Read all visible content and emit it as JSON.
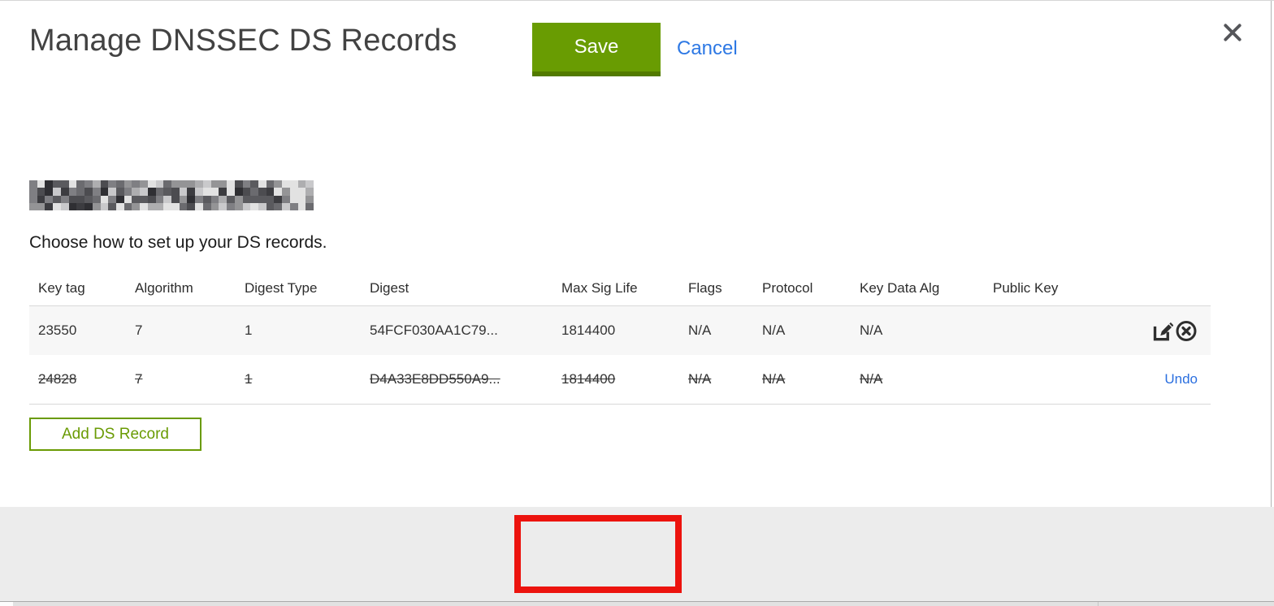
{
  "modal": {
    "title": "Manage DNSSEC DS Records"
  },
  "intro": "Choose how to set up your DS records.",
  "table": {
    "headers": [
      "Key tag",
      "Algorithm",
      "Digest Type",
      "Digest",
      "Max Sig Life",
      "Flags",
      "Protocol",
      "Key Data Alg",
      "Public Key"
    ],
    "rows": [
      {
        "key_tag": "23550",
        "algorithm": "7",
        "digest_type": "1",
        "digest": "54FCF030AA1C79...",
        "max_sig_life": "1814400",
        "flags": "N/A",
        "protocol": "N/A",
        "key_data_alg": "N/A",
        "public_key": "",
        "state": "normal"
      },
      {
        "key_tag": "24828",
        "algorithm": "7",
        "digest_type": "1",
        "digest": "D4A33E8DD550A9...",
        "max_sig_life": "1814400",
        "flags": "N/A",
        "protocol": "N/A",
        "key_data_alg": "N/A",
        "public_key": "",
        "state": "deleted",
        "undo_label": "Undo"
      }
    ]
  },
  "buttons": {
    "add_ds_record": "Add DS Record",
    "save": "Save",
    "cancel": "Cancel"
  },
  "icons": {
    "close": "close-icon",
    "edit": "edit-record-icon",
    "delete": "delete-record-icon"
  },
  "colors": {
    "action_green": "#699c02",
    "action_green_dark": "#527a00",
    "outline_green": "#6a9b04",
    "annotation_red": "#ec130e",
    "link_blue": "#2d78e4",
    "footer_gray": "#ececec",
    "row_alt_gray": "#f7f7f7"
  }
}
